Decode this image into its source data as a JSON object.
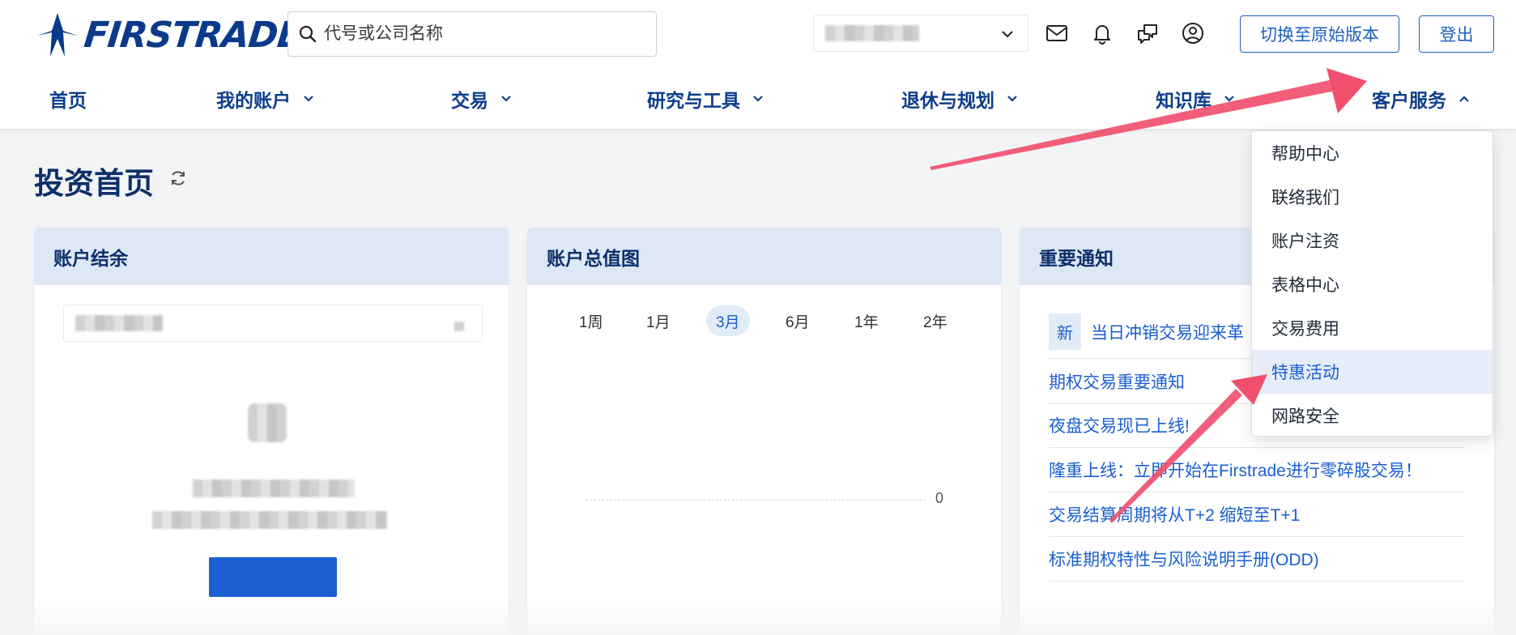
{
  "header": {
    "brand": "FIRSTRADE",
    "search_placeholder": "代号或公司名称",
    "switch_version_label": "切换至原始版本",
    "logout_label": "登出"
  },
  "nav": {
    "items": [
      {
        "label": "首页"
      },
      {
        "label": "我的账户"
      },
      {
        "label": "交易"
      },
      {
        "label": "研究与工具"
      },
      {
        "label": "退休与规划"
      },
      {
        "label": "知识库"
      },
      {
        "label": "客户服务"
      }
    ]
  },
  "page": {
    "title": "投资首页"
  },
  "balance_card": {
    "title": "账户结余"
  },
  "chart_card": {
    "title": "账户总值图",
    "ranges": [
      "1周",
      "1月",
      "3月",
      "6月",
      "1年",
      "2年"
    ],
    "active_range": "3月",
    "zero_label": "0"
  },
  "notice_card": {
    "title": "重要通知",
    "badge": "新",
    "items": [
      "当日冲销交易迎来革",
      "期权交易重要通知",
      "夜盘交易现已上线!",
      "隆重上线：立即开始在Firstrade进行零碎股交易！",
      "交易结算周期将从T+2 缩短至T+1",
      "标准期权特性与风险说明手册(ODD)"
    ]
  },
  "dropdown": {
    "items": [
      "帮助中心",
      "联络我们",
      "账户注资",
      "表格中心",
      "交易费用",
      "特惠活动",
      "网路安全"
    ],
    "active_item": "特惠活动"
  },
  "colors": {
    "brand": "#0b3a8a",
    "link": "#1b5fd1",
    "card_header": "#dde7f5",
    "arrow": "#f0506e"
  },
  "icons": [
    "search-icon",
    "chevron-down-icon",
    "mail-icon",
    "bell-icon",
    "chat-icon",
    "user-icon",
    "chevron-up-icon",
    "refresh-icon"
  ]
}
